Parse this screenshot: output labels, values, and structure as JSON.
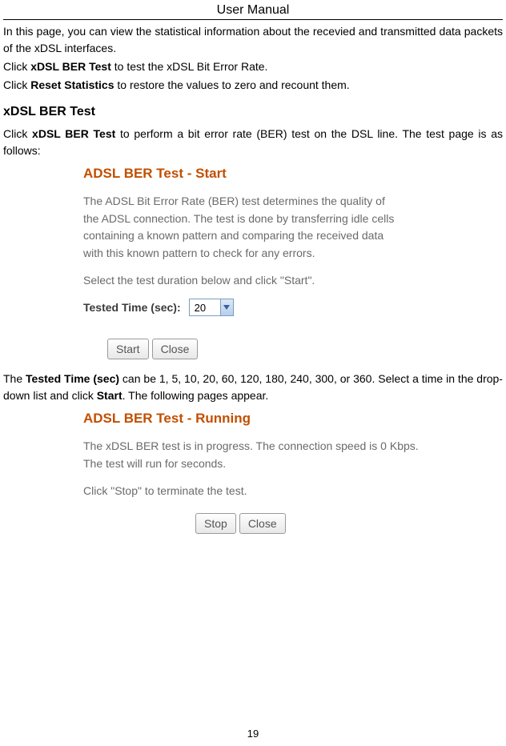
{
  "header": {
    "title": "User Manual"
  },
  "intro": {
    "p1": "In this page, you can view the statistical information about the recevied and transmitted data packets of the xDSL interfaces.",
    "p2_pre": "Click ",
    "p2_bold": "xDSL BER Test",
    "p2_post": " to test the xDSL Bit Error Rate.",
    "p3_pre": "Click ",
    "p3_bold": "Reset Statistics",
    "p3_post": " to restore the values to zero and recount them."
  },
  "section1": {
    "heading": "xDSL BER Test",
    "p1_pre": "Click ",
    "p1_bold": "xDSL BER Test",
    "p1_post": " to perform a bit error rate (BER) test on the DSL line. The test page is as follows:"
  },
  "embedded1": {
    "title": "ADSL BER Test - Start",
    "desc": "The ADSL Bit Error Rate (BER) test determines the quality of the ADSL connection. The test is done by transferring idle cells containing a known pattern and comparing the received data with this known pattern to check for any errors.",
    "instruction": "Select the test duration below and click \"Start\".",
    "field_label": "Tested Time (sec):",
    "select_value": "20",
    "btn_start": "Start",
    "btn_close": "Close"
  },
  "mid": {
    "p1_pre": "The ",
    "p1_bold1": "Tested Time (sec)",
    "p1_mid": " can be 1, 5, 10, 20, 60, 120, 180, 240, 300, or 360. Select a time in the drop-down list and click ",
    "p1_bold2": "Start",
    "p1_post": ". The following pages appear."
  },
  "embedded2": {
    "title": "ADSL BER Test - Running",
    "desc": "The xDSL BER test is in progress. The connection speed is 0 Kbps. The test will run for seconds.",
    "instruction": "Click \"Stop\" to terminate the test.",
    "btn_stop": "Stop",
    "btn_close": "Close"
  },
  "footer": {
    "page": "19"
  }
}
